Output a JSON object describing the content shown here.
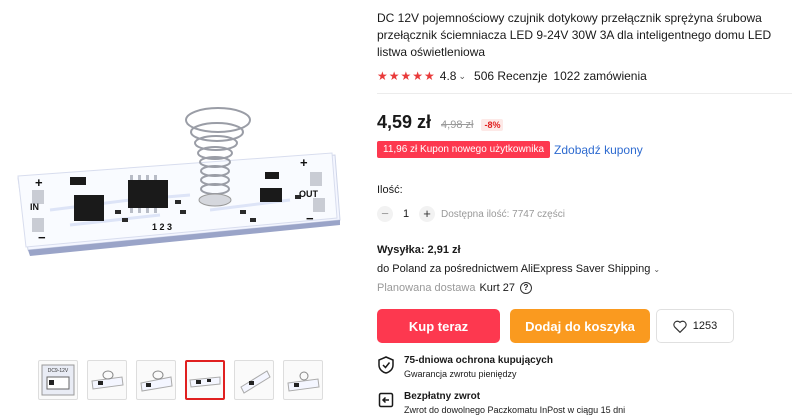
{
  "product": {
    "title": "DC 12V pojemnościowy czujnik dotykowy przełącznik sprężyna śrubowa przełącznik ściemniacza LED 9-24V 30W 3A dla inteligentnego domu LED listwa oświetleniowa",
    "rating_value": "4.8",
    "rating_stars": 5,
    "reviews": "506 Recenzje",
    "orders": "1022 zamówienia"
  },
  "board_labels": {
    "in": "IN",
    "out": "OUT",
    "plus": "+",
    "minus": "−",
    "pins": "1 2 3"
  },
  "price": {
    "current": "4,59 zł",
    "original": "4,98 zł",
    "discount": "-8%"
  },
  "coupon": {
    "label": "11,96 zł Kupon nowego użytkownika",
    "link": "Zdobądź kupony"
  },
  "quantity": {
    "label": "Ilość:",
    "value": "1",
    "available": "Dostępna ilość: 7747 części"
  },
  "shipping": {
    "title": "Wysyłka: 2,91 zł",
    "via": "do Poland za pośrednictwem AliExpress Saver Shipping",
    "delivery_label": "Planowana dostawa",
    "delivery_value": "Kurt 27"
  },
  "actions": {
    "buy_now": "Kup teraz",
    "add_to_cart": "Dodaj do koszyka",
    "wishlist_count": "1253"
  },
  "features": [
    {
      "title": "75-dniowa ochrona kupujących",
      "subtitle": "Gwarancja zwrotu pieniędzy",
      "icon": "shield-check-icon"
    },
    {
      "title": "Bezpłatny zwrot",
      "subtitle": "Zwrot do dowolnego Paczkomatu InPost w ciągu 15 dni",
      "icon": "return-icon"
    }
  ],
  "thumbnails": {
    "count": 6,
    "active_index": 3,
    "first_label": "DC9-12V"
  },
  "colors": {
    "accent_red": "#fd384f",
    "accent_orange": "#fa9a1f",
    "link_blue": "#2e6bd0",
    "star_red": "#e93a3a"
  }
}
